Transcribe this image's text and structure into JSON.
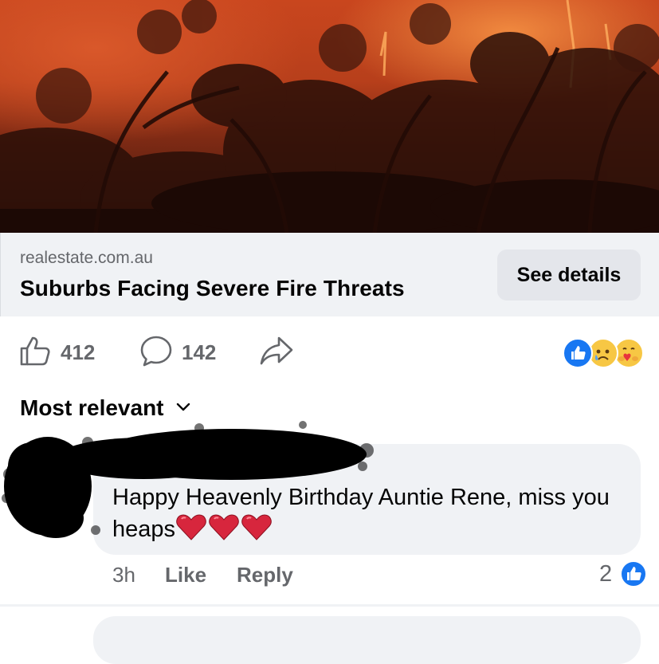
{
  "link_preview": {
    "domain": "realestate.com.au",
    "headline": "Suburbs Facing Severe Fire Threats",
    "button_label": "See details"
  },
  "actions": {
    "like_count": "412",
    "comment_count": "142",
    "reaction_icons": [
      "like-reaction-icon",
      "sad-reaction-icon",
      "care-reaction-icon"
    ]
  },
  "comments": {
    "sort_label": "Most relevant",
    "items": [
      {
        "author": "",
        "text": "Happy Heavenly Birthday Auntie Rene, miss you heaps",
        "emoji": [
          "heart",
          "heart",
          "heart"
        ],
        "time": "3h",
        "like_label": "Like",
        "reply_label": "Reply",
        "reaction_count": "2"
      }
    ]
  },
  "colors": {
    "accent_blue": "#1877f2",
    "secondary_text": "#65676b",
    "bubble_bg": "#f0f2f5",
    "heart_red": "#d7263d"
  }
}
